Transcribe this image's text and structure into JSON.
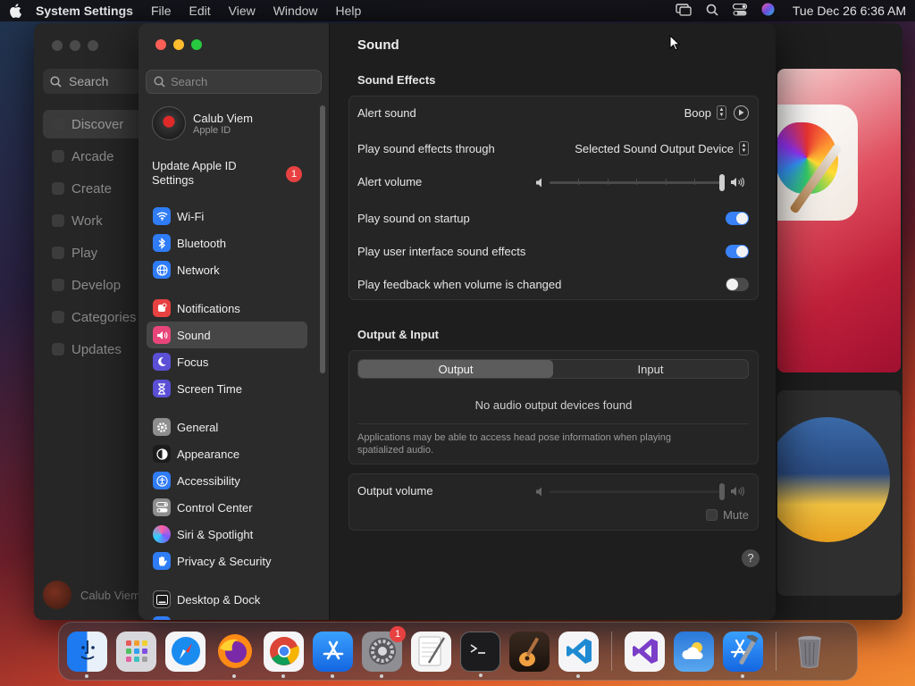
{
  "menubar": {
    "app_name": "System Settings",
    "items": [
      "File",
      "Edit",
      "View",
      "Window",
      "Help"
    ],
    "clock": "Tue Dec 26  6:36 AM"
  },
  "appstore": {
    "search_placeholder": "Search",
    "nav": [
      "Discover",
      "Arcade",
      "Create",
      "Work",
      "Play",
      "Develop",
      "Categories",
      "Updates"
    ],
    "user": "Calub Viem"
  },
  "sidebar": {
    "search_placeholder": "Search",
    "profile_name": "Calub Viem",
    "profile_sub": "Apple ID",
    "update_text": "Update Apple ID Settings",
    "update_badge": "1",
    "group1": [
      {
        "label": "Wi-Fi",
        "icon": "wifi-icon",
        "color": "#2f7cf6"
      },
      {
        "label": "Bluetooth",
        "icon": "bluetooth-icon",
        "color": "#2f7cf6"
      },
      {
        "label": "Network",
        "icon": "globe-icon",
        "color": "#2f7cf6"
      }
    ],
    "group2": [
      {
        "label": "Notifications",
        "icon": "bell-icon",
        "color": "#e84141"
      },
      {
        "label": "Sound",
        "icon": "speaker-icon",
        "color": "#e8467a"
      },
      {
        "label": "Focus",
        "icon": "moon-icon",
        "color": "#5b4fd6"
      },
      {
        "label": "Screen Time",
        "icon": "hourglass-icon",
        "color": "#5b4fd6"
      }
    ],
    "group3": [
      {
        "label": "General",
        "icon": "gear-icon",
        "color": "#8e8e8e"
      },
      {
        "label": "Appearance",
        "icon": "appearance-icon",
        "color": "#1c1c1c"
      },
      {
        "label": "Accessibility",
        "icon": "accessibility-icon",
        "color": "#2f7cf6"
      },
      {
        "label": "Control Center",
        "icon": "control-center-icon",
        "color": "#8e8e8e"
      },
      {
        "label": "Siri & Spotlight",
        "icon": "siri-icon",
        "color": "#7a3fd0"
      },
      {
        "label": "Privacy & Security",
        "icon": "hand-icon",
        "color": "#2f7cf6"
      }
    ],
    "group4": [
      {
        "label": "Desktop & Dock",
        "icon": "dock-icon",
        "color": "#1c1c1c"
      }
    ]
  },
  "main": {
    "title": "Sound",
    "effects_title": "Sound Effects",
    "alert_sound_label": "Alert sound",
    "alert_sound_value": "Boop",
    "play_through_label": "Play sound effects through",
    "play_through_value": "Selected Sound Output Device",
    "alert_volume_label": "Alert volume",
    "alert_volume_level": 1.0,
    "startup_label": "Play sound on startup",
    "startup_on": true,
    "ui_effects_label": "Play user interface sound effects",
    "ui_effects_on": true,
    "feedback_label": "Play feedback when volume is changed",
    "feedback_on": false,
    "output_input_title": "Output & Input",
    "tab_output": "Output",
    "tab_input": "Input",
    "no_devices": "No audio output devices found",
    "head_pose_note": "Applications may be able to access head pose information when playing spatialized audio.",
    "output_volume_label": "Output volume",
    "output_volume_level": 1.0,
    "mute_label": "Mute",
    "help": "?"
  },
  "dock": {
    "apps": [
      "Finder",
      "Launchpad",
      "Safari",
      "Firefox",
      "Chrome",
      "App Store",
      "System Settings",
      "TextEdit",
      "Terminal",
      "GarageBand",
      "Visual Studio Code",
      "Visual Studio",
      "Weather",
      "Xcode",
      "Trash"
    ],
    "settings_badge": "1"
  }
}
